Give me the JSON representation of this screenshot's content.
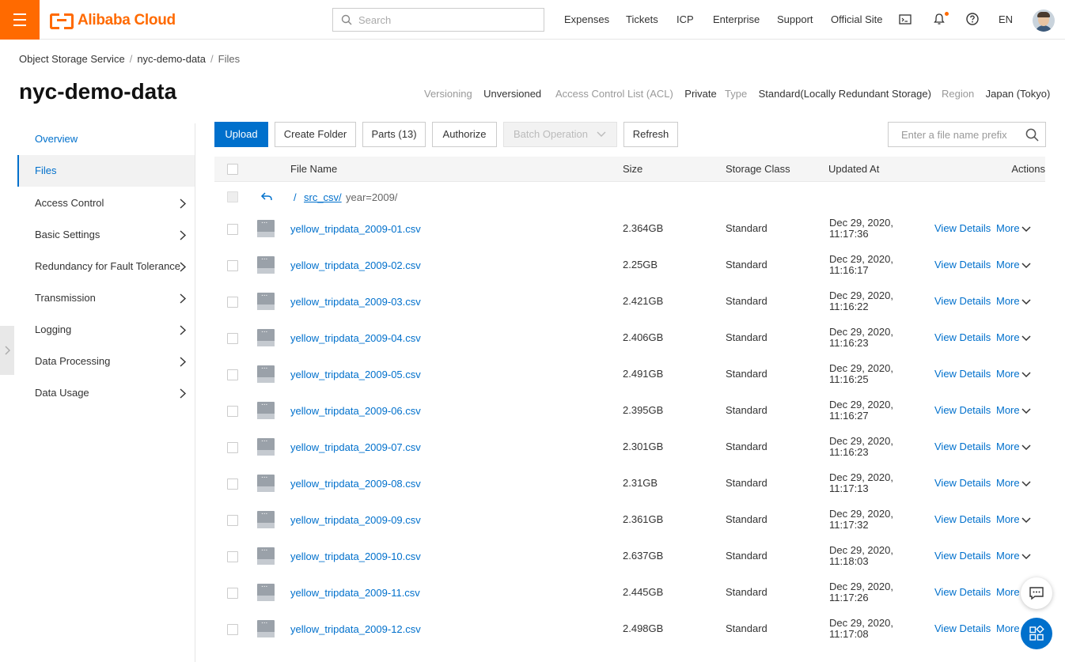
{
  "topbar": {
    "brand": "Alibaba Cloud",
    "search_placeholder": "Search",
    "nav": [
      "Expenses",
      "Tickets",
      "ICP",
      "Enterprise",
      "Support",
      "Official Site"
    ],
    "language": "EN",
    "notification_dot_color": "#ff6a00",
    "brand_color": "#ff6a00"
  },
  "breadcrumb": [
    "Object Storage Service",
    "nyc-demo-data",
    "Files"
  ],
  "bucket": {
    "title": "nyc-demo-data",
    "meta": [
      {
        "label": "Versioning",
        "value": "Unversioned"
      },
      {
        "label": "Access Control List (ACL)",
        "value": "Private"
      },
      {
        "label": "Type",
        "value": "Standard(Locally Redundant Storage)"
      },
      {
        "label": "Region",
        "value": "Japan (Tokyo)"
      }
    ]
  },
  "sidebar": {
    "items": [
      {
        "label": "Overview",
        "icon": "none"
      },
      {
        "label": "Files",
        "icon": "none"
      },
      {
        "label": "Access Control",
        "icon": "chevron-right-icon"
      },
      {
        "label": "Basic Settings",
        "icon": "chevron-right-icon"
      },
      {
        "label": "Redundancy for Fault Tolerance",
        "icon": "chevron-right-icon"
      },
      {
        "label": "Transmission",
        "icon": "chevron-right-icon"
      },
      {
        "label": "Logging",
        "icon": "chevron-right-icon"
      },
      {
        "label": "Data Processing",
        "icon": "chevron-right-icon"
      },
      {
        "label": "Data Usage",
        "icon": "chevron-right-icon"
      }
    ],
    "active": "Files"
  },
  "toolbar": {
    "upload": "Upload",
    "create_folder": "Create Folder",
    "parts": "Parts (13)",
    "authorize": "Authorize",
    "batch_operation": "Batch Operation",
    "refresh": "Refresh",
    "prefix_placeholder": "Enter a file name prefix",
    "accent_color": "#0070cc"
  },
  "table": {
    "columns": [
      "File Name",
      "Size",
      "Storage Class",
      "Updated At",
      "Actions"
    ],
    "path": {
      "root": "/",
      "folder": "src_csv/",
      "current": "year=2009/"
    },
    "rows": [
      {
        "name": "yellow_tripdata_2009-01.csv",
        "size": "2.364GB",
        "class": "Standard",
        "date": "Dec 29, 2020,",
        "time": "11:17:36"
      },
      {
        "name": "yellow_tripdata_2009-02.csv",
        "size": "2.25GB",
        "class": "Standard",
        "date": "Dec 29, 2020,",
        "time": "11:16:17"
      },
      {
        "name": "yellow_tripdata_2009-03.csv",
        "size": "2.421GB",
        "class": "Standard",
        "date": "Dec 29, 2020,",
        "time": "11:16:22"
      },
      {
        "name": "yellow_tripdata_2009-04.csv",
        "size": "2.406GB",
        "class": "Standard",
        "date": "Dec 29, 2020,",
        "time": "11:16:23"
      },
      {
        "name": "yellow_tripdata_2009-05.csv",
        "size": "2.491GB",
        "class": "Standard",
        "date": "Dec 29, 2020,",
        "time": "11:16:25"
      },
      {
        "name": "yellow_tripdata_2009-06.csv",
        "size": "2.395GB",
        "class": "Standard",
        "date": "Dec 29, 2020,",
        "time": "11:16:27"
      },
      {
        "name": "yellow_tripdata_2009-07.csv",
        "size": "2.301GB",
        "class": "Standard",
        "date": "Dec 29, 2020,",
        "time": "11:16:23"
      },
      {
        "name": "yellow_tripdata_2009-08.csv",
        "size": "2.31GB",
        "class": "Standard",
        "date": "Dec 29, 2020,",
        "time": "11:17:13"
      },
      {
        "name": "yellow_tripdata_2009-09.csv",
        "size": "2.361GB",
        "class": "Standard",
        "date": "Dec 29, 2020,",
        "time": "11:17:32"
      },
      {
        "name": "yellow_tripdata_2009-10.csv",
        "size": "2.637GB",
        "class": "Standard",
        "date": "Dec 29, 2020,",
        "time": "11:18:03"
      },
      {
        "name": "yellow_tripdata_2009-11.csv",
        "size": "2.445GB",
        "class": "Standard",
        "date": "Dec 29, 2020,",
        "time": "11:17:26"
      },
      {
        "name": "yellow_tripdata_2009-12.csv",
        "size": "2.498GB",
        "class": "Standard",
        "date": "Dec 29, 2020,",
        "time": "11:17:08"
      }
    ],
    "view_details": "View Details",
    "more": "More"
  }
}
